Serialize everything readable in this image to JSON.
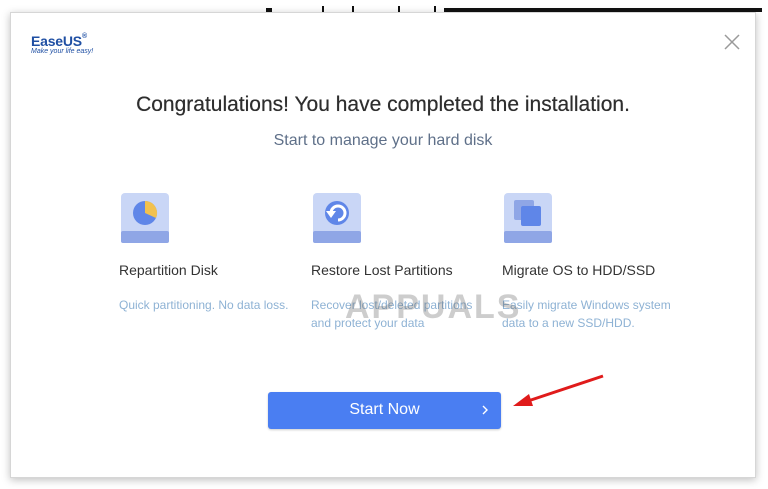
{
  "logo": {
    "name": "EaseUS",
    "registered": "®",
    "tagline": "Make your life easy!"
  },
  "dialog": {
    "heading": "Congratulations! You have completed the installation.",
    "subheading": "Start to manage your hard disk"
  },
  "features": [
    {
      "icon": "pie-chart-disk-icon",
      "title": "Repartition Disk",
      "desc": "Quick partitioning. No data loss."
    },
    {
      "icon": "restore-disk-icon",
      "title": "Restore Lost Partitions",
      "desc": "Recover lost/deleted partitions and protect your data"
    },
    {
      "icon": "migrate-os-icon",
      "title": "Migrate OS to HDD/SSD",
      "desc": "Easily migrate Windows system data to a new SSD/HDD."
    }
  ],
  "start_button": {
    "label": "Start Now",
    "chevron": "›"
  },
  "watermark": "APPUALS",
  "colors": {
    "accent": "#4a7ef2",
    "icon_body": "#c9d6f6",
    "icon_base": "#8fa6e6",
    "arrow": "#e01b1b"
  }
}
